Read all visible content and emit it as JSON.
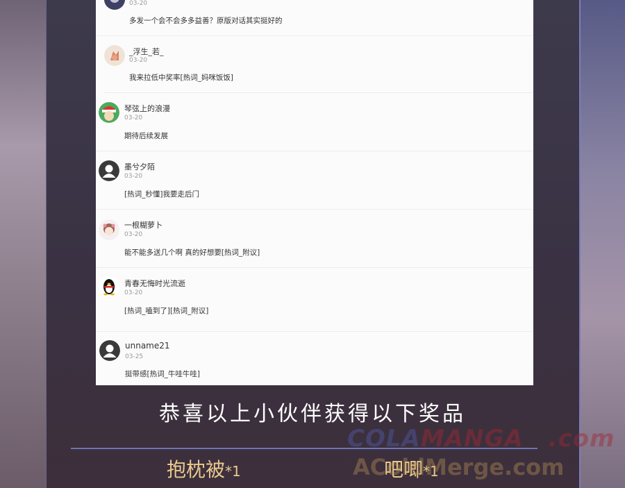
{
  "comments": [
    {
      "name": "",
      "date": "03-20",
      "text": "多发一个会不会多多益善？原版对话其实挺好的",
      "avatar_icon": "dark-avatar-icon"
    },
    {
      "name": "_浮生_若_",
      "date": "03-20",
      "text": "我来拉低中奖率[热词_妈咪饭饭]",
      "avatar_icon": "fox-avatar-icon"
    },
    {
      "name": "琴弦上的浪漫",
      "date": "03-20",
      "text": "期待后续发展",
      "avatar_icon": "santa-avatar-icon"
    },
    {
      "name": "墨兮夕陌",
      "date": "03-20",
      "text": "[热词_秒懂]我要走后门",
      "avatar_icon": "default-avatar-icon"
    },
    {
      "name": "一根糊萝卜",
      "date": "03-20",
      "text": "能不能多送几个啊 真的好想要[热词_附议]",
      "avatar_icon": "girl-avatar-icon"
    },
    {
      "name": "青春无悔时光流逝",
      "date": "03-20",
      "text": "[热词_嗑到了][热词_附议]",
      "avatar_icon": "penguin-avatar-icon"
    },
    {
      "name": "unname21",
      "date": "03-25",
      "text": "挺带感[热词_牛哇牛哇]",
      "avatar_icon": "default-avatar-icon"
    }
  ],
  "headline": "恭喜以上小伙伴获得以下奖品",
  "prizes": [
    {
      "name": "抱枕被",
      "qty": "*1"
    },
    {
      "name": "吧唧",
      "qty": "*1"
    }
  ],
  "watermark": {
    "brand_a": "COLA",
    "brand_b": "MANGA",
    "domain": ".com",
    "line2": "AColdMerge.com"
  },
  "colors": {
    "prize_gold": "#e9c98f",
    "divider_blue": "#6e74b4",
    "card_bg": "#fbfbfb"
  }
}
